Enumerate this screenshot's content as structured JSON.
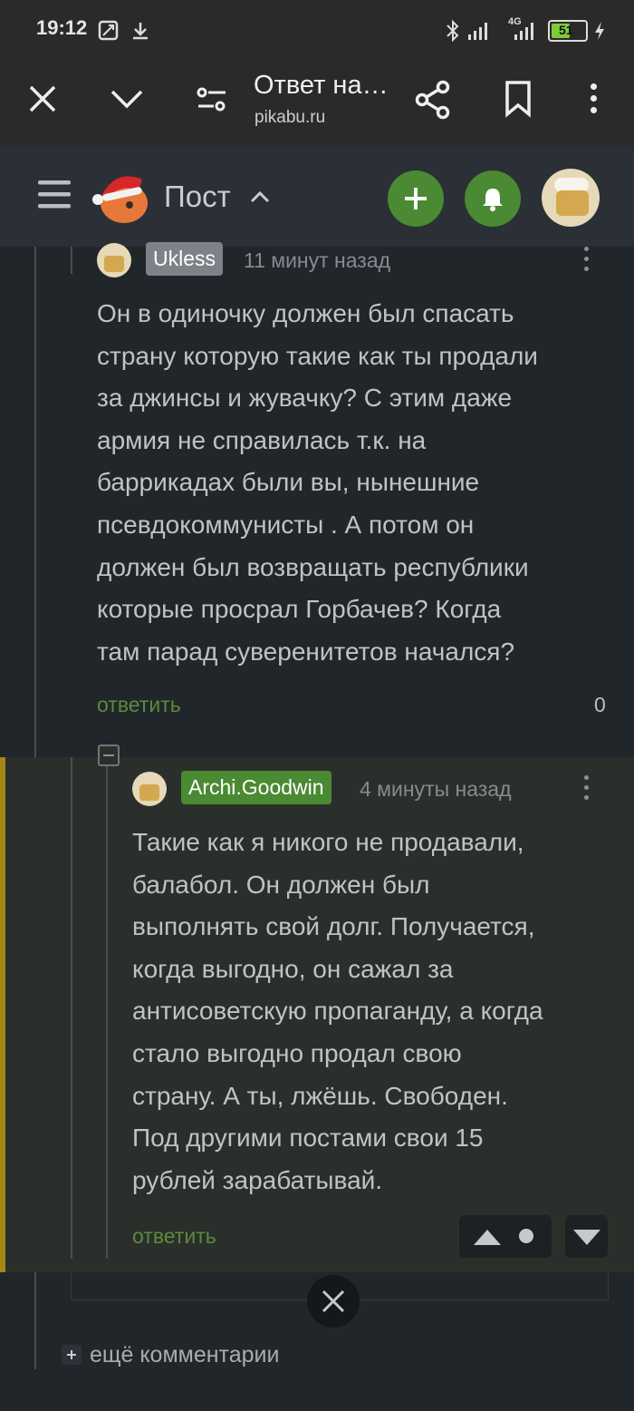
{
  "status_bar": {
    "time": "19:12",
    "battery": "51",
    "network": "4G",
    "icons": [
      "screenshot-icon",
      "download-icon",
      "bluetooth-icon",
      "signal-icon",
      "signal-4g-icon",
      "battery-icon",
      "charging-icon"
    ]
  },
  "browser": {
    "title": "Ответ на…",
    "domain": "pikabu.ru",
    "icons": [
      "close-icon",
      "chevron-down-icon",
      "page-settings-icon",
      "share-icon",
      "bookmark-icon",
      "more-vert-icon"
    ]
  },
  "site_header": {
    "section_label": "Пост",
    "icons": [
      "menu-icon",
      "logo-icon",
      "chevron-up-icon",
      "add-icon",
      "bell-icon",
      "avatar-icon"
    ],
    "colors": {
      "accent_green": "#4a8a32",
      "header_bg": "#2a3036"
    }
  },
  "comments": [
    {
      "username": "Ukless",
      "time_ago": "11 минут назад",
      "lines": [
        "Он в одиночку должен был спасать",
        "страну которую такие как ты продали",
        "за джинсы и жувачку? С этим даже",
        "армия не справилась т.к. на",
        "баррикадах были вы, нынешние",
        "псевдокоммунисты . А потом он",
        "должен был возвращать республики",
        "которые просрал Горбачев? Когда",
        "там парад суверенитетов начался?"
      ],
      "reply_label": "ответить",
      "rating": "0"
    },
    {
      "username": "Archi.Goodwin",
      "time_ago": "4 минуты назад",
      "lines": [
        "Такие как я никого не продавали,",
        "балабол. Он должен был",
        "выполнять свой долг. Получается,",
        "когда выгодно, он сажал за",
        "антисоветскую пропаганду, а когда",
        "стало выгодно продал свою",
        "страну. А ты, лжёшь. Свободен.",
        "Под другими постами свои 15",
        "рублей зарабатывай."
      ],
      "reply_label": "ответить",
      "colors": {
        "username_bg": "#4a8a32",
        "highlight_bar": "#a38714"
      }
    }
  ],
  "more_comments_label": "ещё комментарии"
}
